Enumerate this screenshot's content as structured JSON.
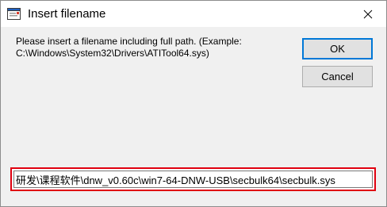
{
  "window": {
    "title": "Insert filename",
    "close_glyph": "✕"
  },
  "dialog": {
    "message_line1": "Please insert a filename including full path. (Example:",
    "message_line2": "C:\\Windows\\System32\\Drivers\\ATITool64.sys)",
    "ok_label": "OK",
    "cancel_label": "Cancel",
    "filename_value": "研发\\课程软件\\dnw_v0.60c\\win7-64-DNW-USB\\secbulk64\\secbulk.sys"
  },
  "icons": {
    "app": "app-window-icon",
    "close": "close-icon"
  },
  "colors": {
    "highlight_border": "#e0000f",
    "default_button_border": "#0078d7"
  }
}
